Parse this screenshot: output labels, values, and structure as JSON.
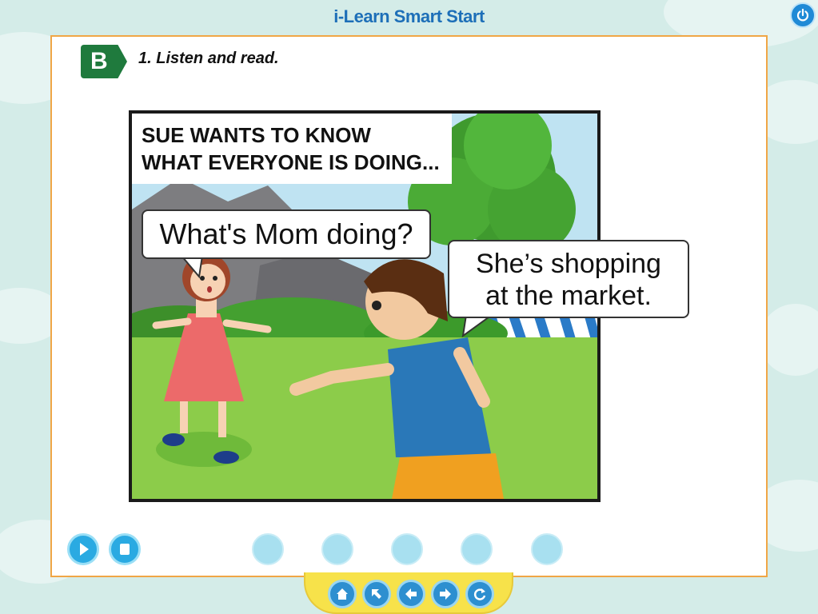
{
  "app": {
    "title": "i-Learn Smart Start"
  },
  "section": {
    "badge": "B",
    "instruction": "1. Listen and read."
  },
  "comic": {
    "caption_line1": "SUE WANTS TO KNOW",
    "caption_line2": "WHAT EVERYONE IS DOING...",
    "bubble_girl": "What's Mom doing?",
    "bubble_boy_line1": "She’s shopping",
    "bubble_boy_line2": "at the market."
  },
  "audio_controls": {
    "play_icon": "play-icon",
    "stop_icon": "stop-icon"
  },
  "page_dots_count": 5,
  "navigation": {
    "buttons": [
      "home-icon",
      "arrow-up-left-icon",
      "arrow-left-icon",
      "arrow-right-icon",
      "refresh-icon"
    ]
  },
  "colors": {
    "accent_blue": "#2aaae2",
    "panel_border": "#f0a646",
    "badge_green": "#1f7a3d",
    "nav_tray_yellow": "#f7e24a"
  }
}
